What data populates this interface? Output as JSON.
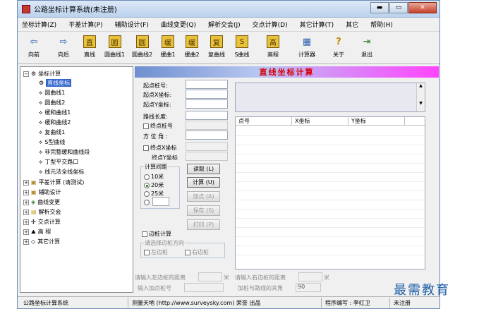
{
  "window": {
    "title": "公路坐标计算系统(未注册)",
    "minimize": "▬",
    "maximize": "▭",
    "close": "✕"
  },
  "menu": [
    "坐标计算(Z)",
    "平差计算(P)",
    "辅助设计(F)",
    "曲线变更(Q)",
    "解析交会(J)",
    "交点计算(D)",
    "其它计算(T)",
    "其它",
    "帮助(H)"
  ],
  "toolbar": [
    {
      "label": "向前",
      "icon": "⇦",
      "name": "back"
    },
    {
      "label": "向后",
      "icon": "⇨",
      "name": "forward"
    },
    {
      "label": "直线",
      "icon": "直",
      "name": "line"
    },
    {
      "label": "圆曲线1",
      "icon": "圆",
      "name": "circle1"
    },
    {
      "label": "圆曲线2",
      "icon": "圆",
      "name": "circle2"
    },
    {
      "label": "缓曲1",
      "icon": "缓",
      "name": "spiral1"
    },
    {
      "label": "缓曲2",
      "icon": "缓",
      "name": "spiral2"
    },
    {
      "label": "复曲线",
      "icon": "复",
      "name": "compound"
    },
    {
      "label": "S曲线",
      "icon": "S",
      "name": "scurve"
    },
    {
      "label": "高程",
      "icon": "高",
      "name": "elevation"
    },
    {
      "label": "计算器",
      "icon": "▦",
      "name": "calculator"
    },
    {
      "label": "关于",
      "icon": "?",
      "name": "about"
    },
    {
      "label": "退出",
      "icon": "⇥",
      "name": "exit"
    }
  ],
  "tree": {
    "root": "坐标计算",
    "children": [
      "直线坐标",
      "圆曲线1",
      "圆曲线2",
      "缓和曲线1",
      "缓和曲线2",
      "复曲线1",
      "S型曲线",
      "非完整缓和曲线段",
      "丁型平交路口",
      "线元法全线坐标"
    ],
    "others": [
      "平差计算 (请测试)",
      "辅助设计",
      "曲线变更",
      "解析交会",
      "交点计算",
      "高  程",
      "其它计算"
    ]
  },
  "form": {
    "title": "直线坐标计算",
    "start_station": "起点桩号:",
    "start_x": "起点X坐标:",
    "start_y": "起点Y坐标:",
    "length": "路线长度:",
    "end_station": "终点桩号",
    "azimuth": "方 位 角 :",
    "end_x": "终点X坐标",
    "end_y": "终点Y坐标",
    "interval_group": "计算间距",
    "r10": "10米",
    "r20": "20米",
    "r25": "25米",
    "read_btn": "读取 (L)",
    "calc_btn": "计算 (U)",
    "add_btn": "加点 (A)",
    "save_btn": "保存 (S)",
    "print_btn": "打印 (P)",
    "side_calc": "边桩计算",
    "side_dir": "请选择边桩方向",
    "left_side": "左边桩",
    "right_side": "右边桩",
    "left_dist": "请输入左边桩的距离",
    "right_dist": "请输入右边桩的距离",
    "unit_m": "米",
    "add_station": "输入加点桩号",
    "angle_label": "加桩与路线的夹角",
    "angle_value": "90"
  },
  "grid": {
    "columns": [
      "点号",
      "X坐标",
      "Y坐标"
    ]
  },
  "status": {
    "app": "公路坐标计算系统",
    "site": "测量天地 (http://www.surveysky.com) 荣誉 出品",
    "author": "程序编写 : 李红卫",
    "reg": "未注册"
  },
  "watermark": "最需教育"
}
